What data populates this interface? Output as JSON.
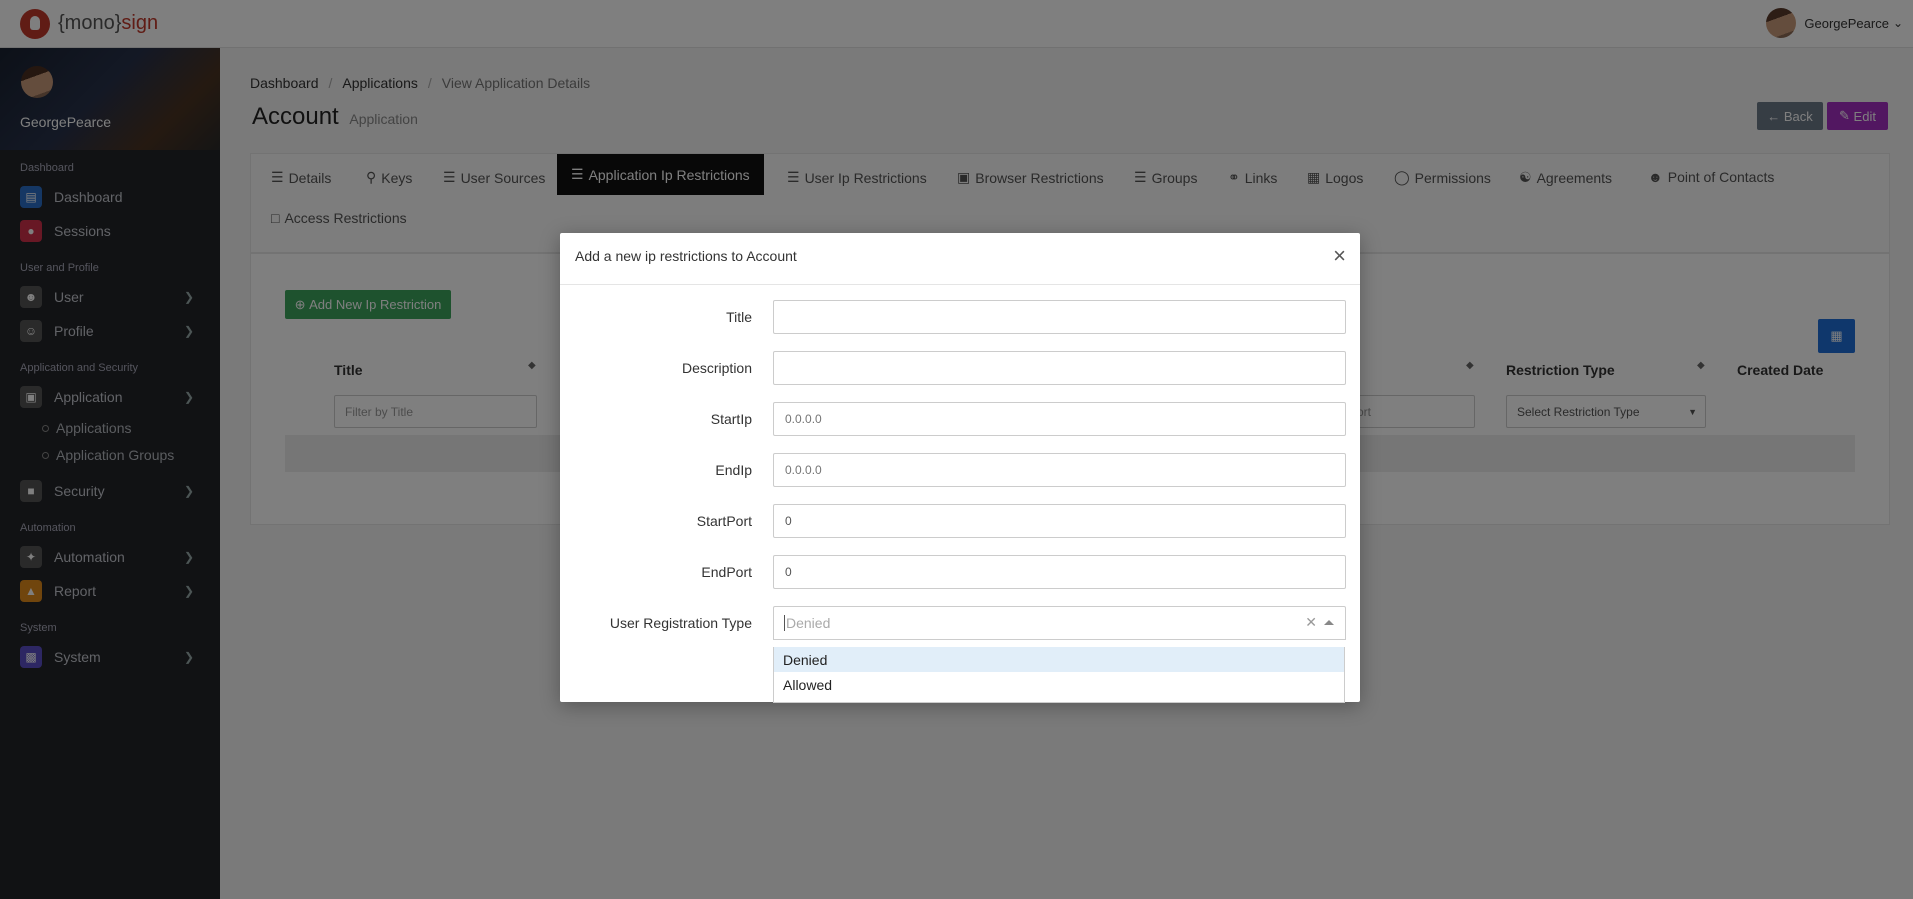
{
  "topbar": {
    "logo_text_prefix": "{mono}",
    "logo_text_suffix": "sign",
    "user_name": "GeorgePearce"
  },
  "sidebar": {
    "profile_name": "GeorgePearce",
    "sections": {
      "dashboard": "Dashboard",
      "user_profile": "User and Profile",
      "app_security": "Application and Security",
      "automation": "Automation",
      "system": "System"
    },
    "items": {
      "dashboard": "Dashboard",
      "sessions": "Sessions",
      "user": "User",
      "profile": "Profile",
      "application": "Application",
      "applications": "Applications",
      "application_groups": "Application Groups",
      "security": "Security",
      "automation": "Automation",
      "report": "Report",
      "system": "System"
    }
  },
  "breadcrumb": [
    "Dashboard",
    "Applications",
    "View Application Details"
  ],
  "page": {
    "title": "Account",
    "subtitle": "Application",
    "back_label": "Back",
    "edit_label": "Edit"
  },
  "tabs": [
    "Details",
    "Keys",
    "User Sources",
    "Application Ip Restrictions",
    "User Ip Restrictions",
    "Browser Restrictions",
    "Groups",
    "Links",
    "Logos",
    "Permissions",
    "Agreements",
    "Point of Contacts",
    "Access Restrictions"
  ],
  "table": {
    "add_button": "Add New Ip Restriction",
    "headers": {
      "title": "Title",
      "restriction_type": "Restriction Type",
      "created_date": "Created Date"
    },
    "filters": {
      "title_placeholder": "Filter by Title",
      "port_partial": "ort",
      "restriction_type_placeholder": "Select Restriction Type"
    }
  },
  "modal": {
    "title": "Add a new ip restrictions to Account",
    "close_symbol": "×",
    "fields": {
      "title_label": "Title",
      "title_value": "",
      "description_label": "Description",
      "description_value": "",
      "start_ip_label": "StartIp",
      "start_ip_placeholder": "0.0.0.0",
      "end_ip_label": "EndIp",
      "end_ip_placeholder": "0.0.0.0",
      "start_port_label": "StartPort",
      "start_port_value": "0",
      "end_port_label": "EndPort",
      "end_port_value": "0",
      "registration_type_label": "User Registration Type",
      "registration_type_selected": "Denied",
      "registration_type_options": [
        "Denied",
        "Allowed"
      ]
    }
  }
}
